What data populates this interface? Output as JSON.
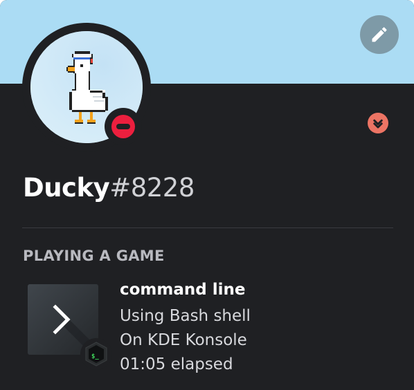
{
  "profile": {
    "username": "Ducky",
    "discriminator": "#8228",
    "status": "do-not-disturb",
    "avatar_icon": "pixel-goose-avatar",
    "banner_color": "#abdcf4",
    "status_color": "#ec1f3e",
    "badge_color": "#ec7464"
  },
  "activity": {
    "section_title": "PLAYING A GAME",
    "name": "command line",
    "details": "Using Bash shell",
    "state": "On KDE Konsole",
    "elapsed": "01:05 elapsed",
    "large_icon": "terminal-chevron-icon",
    "small_icon": "bash-terminal-icon"
  },
  "icons": {
    "edit": "pencil-icon",
    "badge": "chevron-down-icon",
    "status": "dnd-status-icon"
  }
}
